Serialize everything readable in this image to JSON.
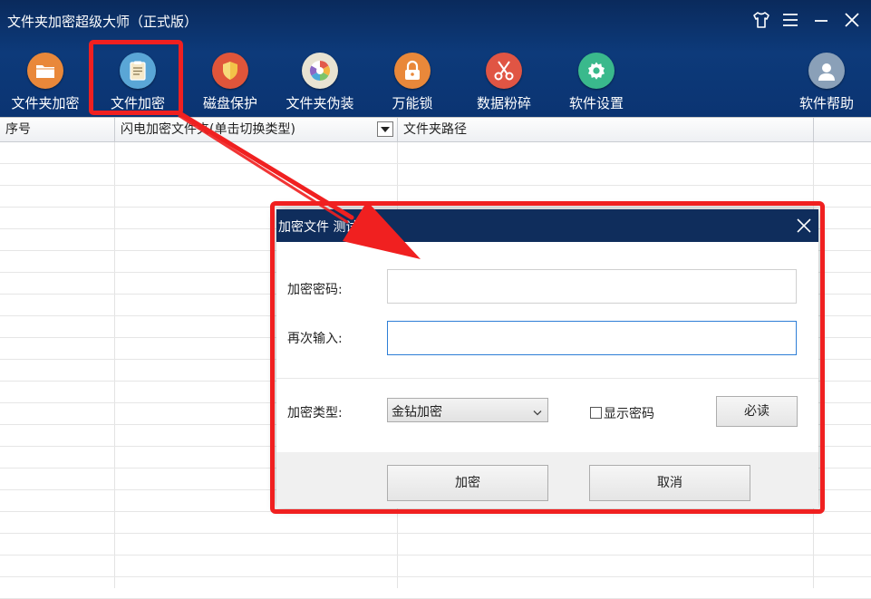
{
  "window": {
    "title": "文件夹加密超级大师（正式版）",
    "controls": [
      "skin-icon",
      "menu-icon",
      "minimize-icon",
      "close-icon"
    ]
  },
  "toolbar": {
    "items": [
      {
        "label": "文件夹加密",
        "icon": "folder-icon",
        "color": "#e9883a"
      },
      {
        "label": "文件加密",
        "icon": "document-icon",
        "color": "#5aa6d6"
      },
      {
        "label": "磁盘保护",
        "icon": "shield-icon",
        "color": "#e0553a"
      },
      {
        "label": "文件夹伪装",
        "icon": "color-wheel-icon",
        "color": "#e8e3d2"
      },
      {
        "label": "万能锁",
        "icon": "padlock-icon",
        "color": "#e9883a"
      },
      {
        "label": "数据粉碎",
        "icon": "scissors-icon",
        "color": "#e05544"
      },
      {
        "label": "软件设置",
        "icon": "gear-icon",
        "color": "#3ab98c"
      }
    ],
    "help": {
      "label": "软件帮助",
      "icon": "user-avatar-icon",
      "color": "#8aa0b8"
    },
    "selected_index": 1,
    "highlight_color": "#f02020"
  },
  "table": {
    "columns": [
      "序号",
      "闪电加密文件夹(单击切换类型)",
      "文件夹路径",
      ""
    ],
    "rows": []
  },
  "dialog": {
    "title": "加密文件  测试.txt",
    "password_label": "加密密码:",
    "confirm_label": "再次输入:",
    "password_value": "",
    "confirm_value": "",
    "type_label": "加密类型:",
    "type_value": "金钻加密",
    "show_password_label": "显示密码",
    "show_password_checked": false,
    "must_read_label": "必读",
    "encrypt_label": "加密",
    "cancel_label": "取消"
  }
}
